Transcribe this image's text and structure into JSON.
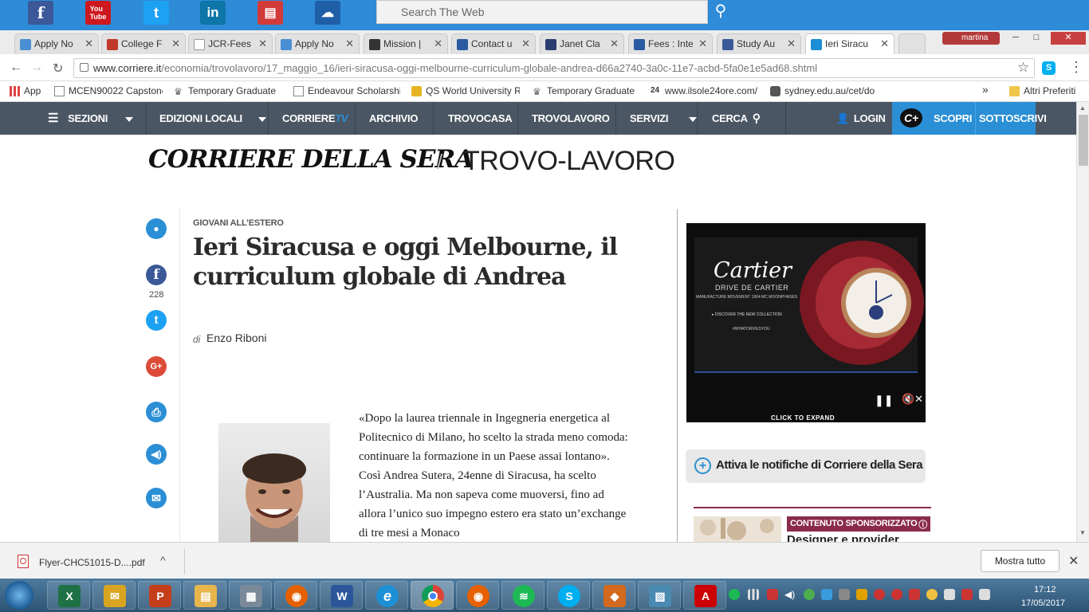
{
  "top_toolbar": {
    "icons": [
      {
        "name": "facebook-icon",
        "glyph": "f",
        "color": "#3b5998"
      },
      {
        "name": "youtube-icon",
        "glyph": "You\nTube",
        "color": "#cc181e"
      },
      {
        "name": "twitter-icon",
        "glyph": "t",
        "color": "#1da1f2"
      },
      {
        "name": "linkedin-icon",
        "glyph": "in",
        "color": "#0e76a8"
      },
      {
        "name": "news-icon",
        "glyph": "▤",
        "color": "#d23a3a"
      },
      {
        "name": "weather-icon",
        "glyph": "☁",
        "color": "#1f5fa8"
      }
    ],
    "search_placeholder": "Search The Web"
  },
  "tabs": [
    {
      "label": "Apply No",
      "icon_color": "#4a8fd4"
    },
    {
      "label": "College F",
      "icon_color": "#c0392b"
    },
    {
      "label": "JCR-Fees",
      "icon_color": "#ffffff"
    },
    {
      "label": "Apply No",
      "icon_color": "#4a8fd4"
    },
    {
      "label": "Mission |",
      "icon_color": "#333333"
    },
    {
      "label": "Contact u",
      "icon_color": "#2c5aa0"
    },
    {
      "label": "Janet Cla",
      "icon_color": "#2c3e70"
    },
    {
      "label": "Fees : Inte",
      "icon_color": "#2c5aa0"
    },
    {
      "label": "Study Au",
      "icon_color": "#3b5998"
    },
    {
      "label": "Ieri Siracu",
      "icon_color": "#1b8ed6"
    }
  ],
  "window": {
    "user": "martina",
    "minimize": "─",
    "maximize": "□",
    "close": "✕"
  },
  "address_bar": {
    "back": "←",
    "forward": "→",
    "reload": "↻",
    "host": "www.corriere.it",
    "path": "/economia/trovolavoro/17_maggio_16/ieri-siracusa-oggi-melbourne-curriculum-globale-andrea-d66a2740-3a0c-11e7-acbd-5fa0e1e5ad68.shtml",
    "star": "☆"
  },
  "bookmarks": {
    "items": [
      {
        "label": "App",
        "icon_color": "#d44"
      },
      {
        "label": "MCEN90022 Capstone",
        "icon_color": "#888"
      },
      {
        "label": "Temporary Graduate",
        "icon_color": "#666"
      },
      {
        "label": "Endeavour Scholarship",
        "icon_color": "#888"
      },
      {
        "label": "QS World University R",
        "icon_color": "#e6b422"
      },
      {
        "label": "Temporary Graduate",
        "icon_color": "#666"
      },
      {
        "label": "www.ilsole24ore.com/",
        "icon_color": "#444"
      },
      {
        "label": "sydney.edu.au/cet/do",
        "icon_color": "#555"
      }
    ],
    "more": "»",
    "other": "Altri Preferiti"
  },
  "site_nav": {
    "sezioni": "SEZIONI",
    "edizioni": "EDIZIONI LOCALI",
    "corriere": "CORRIERE",
    "corriere_tv": "TV",
    "archivio": "ARCHIVIO",
    "trovocasa": "TROVOCASA",
    "trovolavoro": "TROVOLAVORO",
    "servizi": "SERVIZI",
    "cerca": "CERCA",
    "login": "LOGIN",
    "cplus": "C+",
    "scopri": "SCOPRI",
    "sottoscrivi": "SOTTOSCRIVI",
    "accent": "#2b8fd6"
  },
  "masthead": {
    "logo": "CORRIERE DELLA SERA",
    "slash": "/",
    "section": "TROVO-LAVORO"
  },
  "share": {
    "count": "228",
    "colors": {
      "comment": "#2b8fd6",
      "facebook": "#3b5998",
      "twitter": "#1da1f2",
      "gplus": "#dd4b39",
      "print": "#2b8fd6",
      "audio": "#2b8fd6",
      "email": "#2b8fd6"
    },
    "glyphs": {
      "comment": "💬",
      "facebook": "f",
      "twitter": "t",
      "gplus": "G+",
      "print": "⎙",
      "audio": "🔊",
      "email": "✉"
    }
  },
  "article": {
    "kicker": "GIOVANI ALL’ESTERO",
    "headline": "Ieri Siracusa e oggi Melbourne, il curriculum globale di Andrea",
    "byline_prefix": "di",
    "author": "Enzo Riboni",
    "body": "«Dopo la laurea triennale in Ingegneria energetica al Politecnico di Milano, ho scelto la strada meno comoda: continuare la formazione in un Paese assai lontano». Così Andrea Sutera, 24enne di Siracusa, ha scelto l’Australia. Ma non sapeva come muoversi, fino ad allora l’unico suo impegno estero era stato un’exchange di tre mesi a Monaco"
  },
  "ad": {
    "brand": "Cartier",
    "subbrand": "DRIVE DE CARTIER",
    "tagline": "MANUFACTURE MOVEMENT 1904 MC MOONPHASES",
    "cta": "DISCOVER THE NEW COLLECTION",
    "hashtag": "#WHATDRIVESYOU",
    "expand": "CLICK TO EXPAND",
    "pause": "❚❚",
    "mute": "🔇✕"
  },
  "notify": {
    "label": "Attiva le notifiche di Corriere della Sera",
    "plus": "+"
  },
  "sponsored": {
    "badge": "CONTENUTO SPONSORIZZATO",
    "info": "ⓘ",
    "title": "Designer e provider"
  },
  "download_bar": {
    "filename": "Flyer-CHC51015-D....pdf",
    "caret": "^",
    "show_all": "Mostra tutto",
    "close": "✕"
  },
  "taskbar": {
    "apps": [
      {
        "name": "excel-icon",
        "glyph": "X",
        "color": "#1e7145"
      },
      {
        "name": "mail-icon",
        "glyph": "✉",
        "color": "#d9a520"
      },
      {
        "name": "powerpoint-icon",
        "glyph": "P",
        "color": "#c43e1c"
      },
      {
        "name": "explorer-icon",
        "glyph": "▤",
        "color": "#e8b64c"
      },
      {
        "name": "calculator-icon",
        "glyph": "▦",
        "color": "#7a8a9a"
      },
      {
        "name": "firefox-icon",
        "glyph": "◉",
        "color": "#e66000"
      },
      {
        "name": "word-icon",
        "glyph": "W",
        "color": "#2b579a"
      },
      {
        "name": "ie-icon",
        "glyph": "e",
        "color": "#1e90d6"
      },
      {
        "name": "chrome-icon",
        "glyph": "◎",
        "color": "#3b9a3b"
      },
      {
        "name": "firefox2-icon",
        "glyph": "◉",
        "color": "#e66000"
      },
      {
        "name": "spotify-icon",
        "glyph": "≋",
        "color": "#1db954"
      },
      {
        "name": "skype-icon",
        "glyph": "S",
        "color": "#00aff0"
      },
      {
        "name": "matlab-icon",
        "glyph": "◆",
        "color": "#d2691e"
      },
      {
        "name": "photos-icon",
        "glyph": "▨",
        "color": "#4a8ab0"
      },
      {
        "name": "acrobat-icon",
        "glyph": "A",
        "color": "#c00"
      }
    ],
    "time": "17:12",
    "date": "17/05/2017"
  }
}
